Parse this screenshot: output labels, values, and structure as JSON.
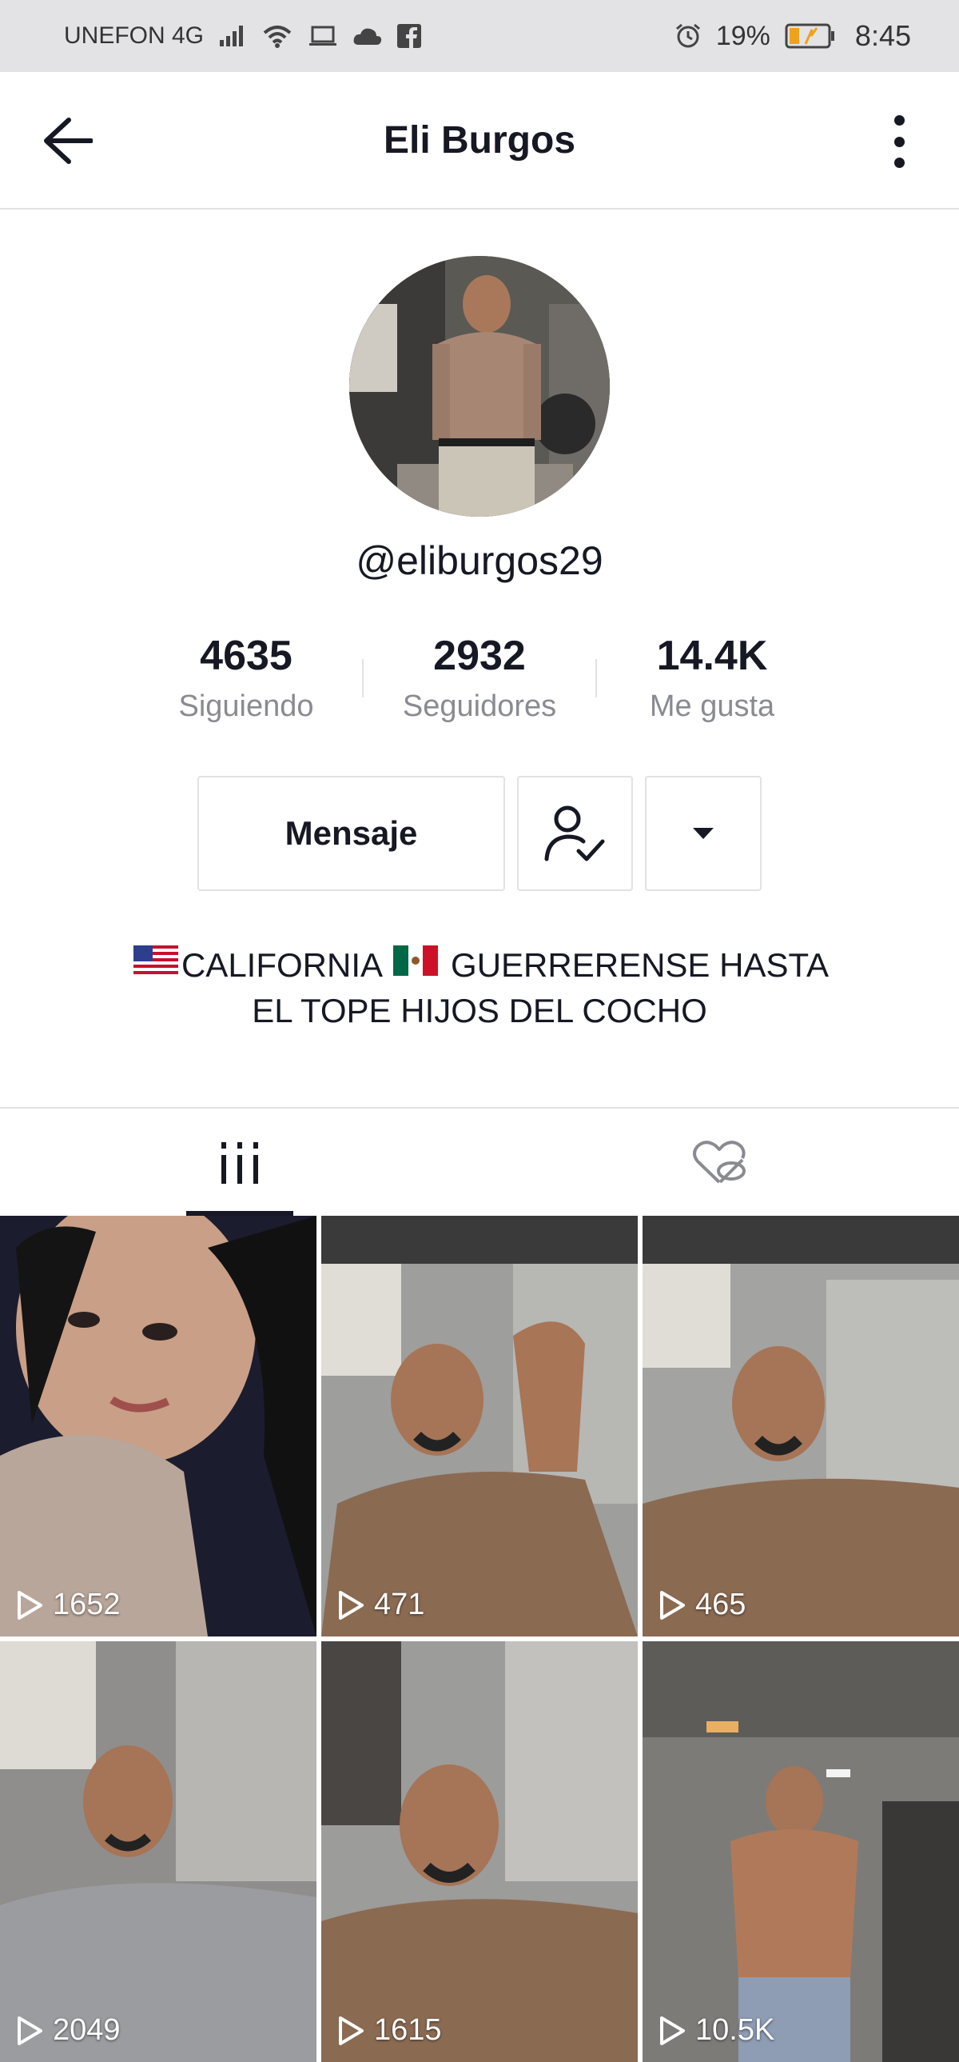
{
  "status_bar": {
    "carrier": "UNEFON 4G",
    "battery": "19%",
    "time": "8:45",
    "icons": [
      "signal-icon",
      "wifi-icon",
      "laptop-icon",
      "cloud-icon",
      "facebook-icon",
      "alarm-icon",
      "battery-icon"
    ]
  },
  "header": {
    "title": "Eli Burgos",
    "back_icon": "arrow-left-icon",
    "more_icon": "more-vertical-icon"
  },
  "profile": {
    "username": "@eliburgos29",
    "stats": [
      {
        "value": "4635",
        "label": "Siguiendo"
      },
      {
        "value": "2932",
        "label": "Seguidores"
      },
      {
        "value": "14.4K",
        "label": "Me gusta"
      }
    ],
    "buttons": {
      "message": "Mensaje",
      "follow_icon": "user-check-icon",
      "dropdown_icon": "caret-down-icon"
    },
    "bio_line1_a": "CALIFORNIA",
    "bio_line1_b": "GUERRERENSE HASTA",
    "bio_line2": "EL TOPE HIJOS DEL COCHO"
  },
  "tabs": [
    {
      "name": "videos",
      "icon": "grid-icon",
      "active": true
    },
    {
      "name": "liked",
      "icon": "heart-hidden-icon",
      "active": false
    }
  ],
  "videos": [
    {
      "views": "1652"
    },
    {
      "views": "471"
    },
    {
      "views": "465"
    },
    {
      "views": "2049"
    },
    {
      "views": "1615"
    },
    {
      "views": "10.5K"
    }
  ]
}
